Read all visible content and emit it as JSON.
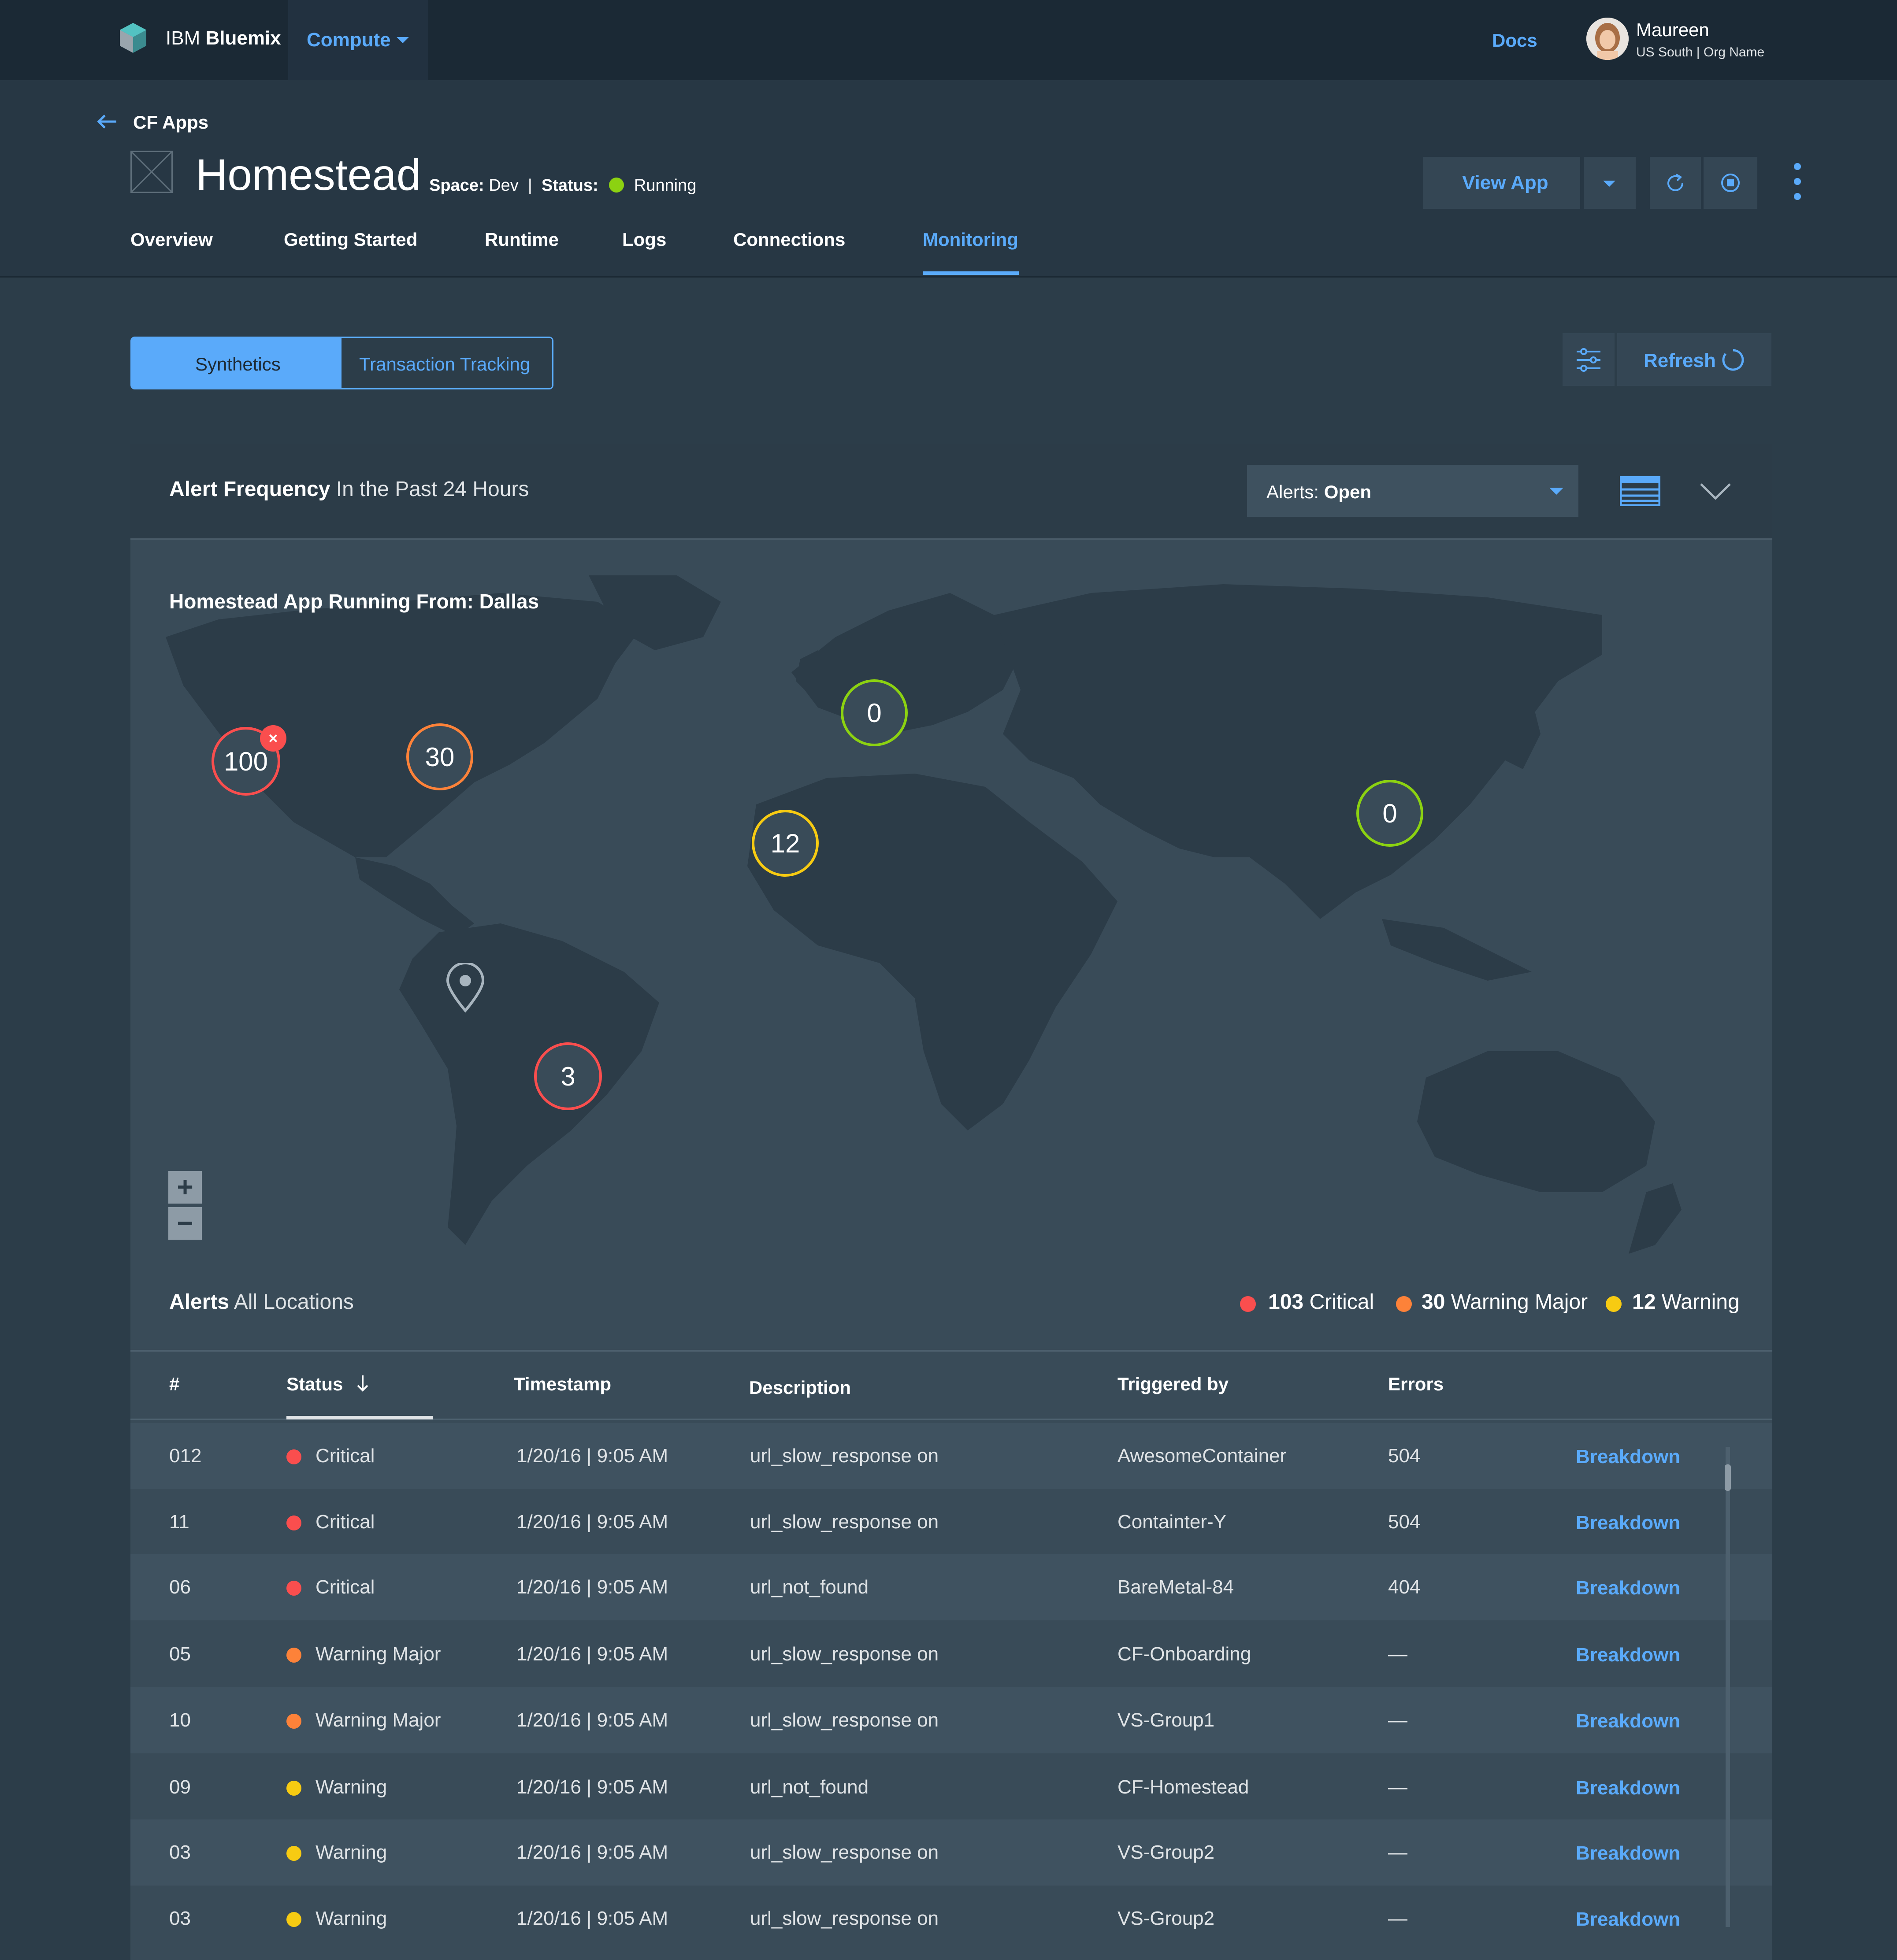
{
  "topbar": {
    "brand_prefix": "IBM",
    "brand_name": "Bluemix",
    "compute_label": "Compute",
    "docs_label": "Docs",
    "user_name": "Maureen",
    "user_org": "US South | Org Name"
  },
  "header": {
    "back_label": "CF Apps",
    "app_name": "Homestead",
    "space_label": "Space:",
    "space_value": "Dev",
    "status_label": "Status:",
    "status_value": "Running",
    "view_app_label": "View App",
    "tabs": [
      "Overview",
      "Getting Started",
      "Runtime",
      "Logs",
      "Connections",
      "Monitoring"
    ],
    "active_tab": "Monitoring"
  },
  "toggle": {
    "synthetics": "Synthetics",
    "transaction_tracking": "Transaction Tracking"
  },
  "refresh_label": "Refresh",
  "panel": {
    "title_bold": "Alert Frequency",
    "title_rest": "In the Past 24 Hours",
    "alerts_dropdown_label": "Alerts:",
    "alerts_dropdown_value": "Open"
  },
  "map": {
    "title": "Homestead App Running From: Dallas",
    "markers": [
      {
        "value": "100",
        "level": "critical",
        "error_badge": true
      },
      {
        "value": "30",
        "level": "warning-major"
      },
      {
        "value": "0",
        "level": "ok"
      },
      {
        "value": "12",
        "level": "warning"
      },
      {
        "value": "0",
        "level": "ok"
      },
      {
        "value": "3",
        "level": "critical"
      }
    ],
    "zoom_in": "+",
    "zoom_out": "−"
  },
  "alerts": {
    "title_bold": "Alerts",
    "title_rest": "All Locations",
    "legend": [
      {
        "count": "103",
        "label": "Critical",
        "color": "#fa4e4e"
      },
      {
        "count": "30",
        "label": "Warning Major",
        "color": "#fd8239"
      },
      {
        "count": "12",
        "label": "Warning",
        "color": "#f7cb12"
      }
    ]
  },
  "table": {
    "columns": [
      "#",
      "Status",
      "Timestamp",
      "Description",
      "Triggered by",
      "Errors"
    ],
    "sort_column": "Status",
    "action_label": "Breakdown",
    "rows": [
      {
        "id": "012",
        "status": "Critical",
        "color": "#fa4e4e",
        "timestamp": "1/20/16 | 9:05 AM",
        "description": "url_slow_response on",
        "triggered_by": "AwesomeContainer",
        "errors": "504"
      },
      {
        "id": "11",
        "status": "Critical",
        "color": "#fa4e4e",
        "timestamp": "1/20/16 | 9:05 AM",
        "description": "url_slow_response on",
        "triggered_by": "Containter-Y",
        "errors": "504"
      },
      {
        "id": "06",
        "status": "Critical",
        "color": "#fa4e4e",
        "timestamp": "1/20/16 | 9:05 AM",
        "description": "url_not_found",
        "triggered_by": "BareMetal-84",
        "errors": "404"
      },
      {
        "id": "05",
        "status": "Warning Major",
        "color": "#fd8239",
        "timestamp": "1/20/16 | 9:05 AM",
        "description": "url_slow_response on",
        "triggered_by": "CF-Onboarding",
        "errors": "—"
      },
      {
        "id": "10",
        "status": "Warning Major",
        "color": "#fd8239",
        "timestamp": "1/20/16 | 9:05 AM",
        "description": "url_slow_response on",
        "triggered_by": "VS-Group1",
        "errors": "—"
      },
      {
        "id": "09",
        "status": "Warning",
        "color": "#f7cb12",
        "timestamp": "1/20/16 | 9:05 AM",
        "description": "url_not_found",
        "triggered_by": "CF-Homestead",
        "errors": "—"
      },
      {
        "id": "03",
        "status": "Warning",
        "color": "#f7cb12",
        "timestamp": "1/20/16 | 9:05 AM",
        "description": "url_slow_response on",
        "triggered_by": "VS-Group2",
        "errors": "—"
      },
      {
        "id": "03",
        "status": "Warning",
        "color": "#f7cb12",
        "timestamp": "1/20/16 | 9:05 AM",
        "description": "url_slow_response on",
        "triggered_by": "VS-Group2",
        "errors": "—"
      }
    ]
  },
  "colors": {
    "accent": "#5aaafa",
    "running": "#8cd211",
    "critical": "#fa4e4e",
    "warning_major": "#fd8239",
    "warning": "#f7cb12",
    "ok": "#8cd211"
  }
}
